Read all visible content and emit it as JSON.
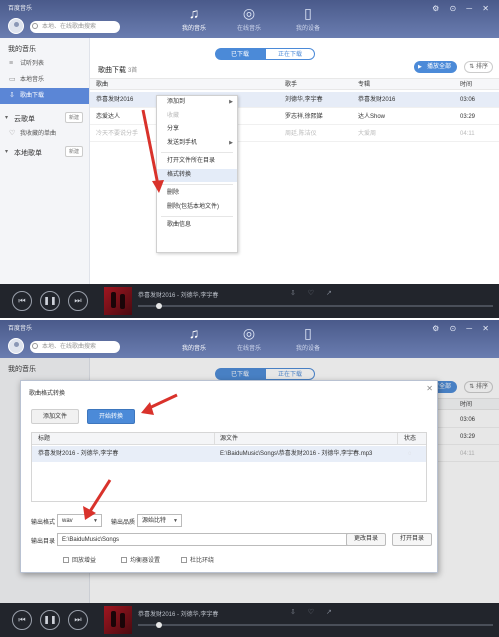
{
  "brand": "百度音乐",
  "search_placeholder": "本地、在线歌曲搜索",
  "nav": [
    "我的音乐",
    "在线音乐",
    "我的设备"
  ],
  "window_controls": "⚙ ⊙ ─ ✕",
  "sidebar": {
    "my_music": "我的音乐",
    "items": [
      "试听列表",
      "本地音乐",
      "歌曲下载"
    ],
    "cloud": "云歌单",
    "new_label": "新建",
    "favorites": "我收藏的单曲",
    "local_playlist": "本地歌单"
  },
  "tabs": {
    "downloaded": "已下载",
    "downloading": "正在下载"
  },
  "download_title": "歌曲下载",
  "download_count": "3首",
  "play_all": "播放全部",
  "sort": "排序",
  "columns": {
    "song": "歌曲",
    "artist": "歌手",
    "album": "专辑",
    "time": "时间"
  },
  "songs": [
    {
      "song": "恭喜发财2016",
      "artist": "刘德华,李宇春",
      "album": "恭喜发财2016",
      "time": "03:06"
    },
    {
      "song": "恋爱达人",
      "artist": "罗志祥,徐熙娣",
      "album": "达人Show",
      "time": "03:29"
    },
    {
      "song": "冷天不要说分手",
      "artist": "周廷,陈洁仪",
      "album": "大爱周",
      "time": "04:11"
    }
  ],
  "context_menu": [
    "添加到",
    "收藏",
    "分享",
    "发送到手机",
    "打开文件所在目录",
    "格式转换",
    "删除",
    "删除(包括本地文件)",
    "歌曲信息"
  ],
  "player": {
    "title": "恭喜发财2016 - 刘德华,李宇春",
    "progress": 0.05
  },
  "dialog": {
    "title": "歌曲格式转换",
    "add_file": "添加文件",
    "start_convert": "开始转换",
    "col_title": "标题",
    "col_source": "源文件",
    "col_status": "状态",
    "row_title": "恭喜发财2016 - 刘德华,李宇春",
    "row_source": "E:\\BaiduMusic\\Songs\\恭喜发财2016 - 刘德华,李宇春.mp3",
    "output_format_label": "输出格式",
    "output_format": "wav",
    "output_quality_label": "输出品质",
    "output_quality": "源始比特",
    "output_dir_label": "输出目录",
    "output_dir": "E:\\BaiduMusic\\Songs",
    "change_dir": "更改目录",
    "open_dir": "打开目录",
    "options": [
      "回放增益",
      "均衡器设置",
      "杜比环绕"
    ]
  },
  "colors": {
    "accent": "#4b8ad8",
    "arrow": "#d9322b",
    "player_bg": "#22252c"
  }
}
